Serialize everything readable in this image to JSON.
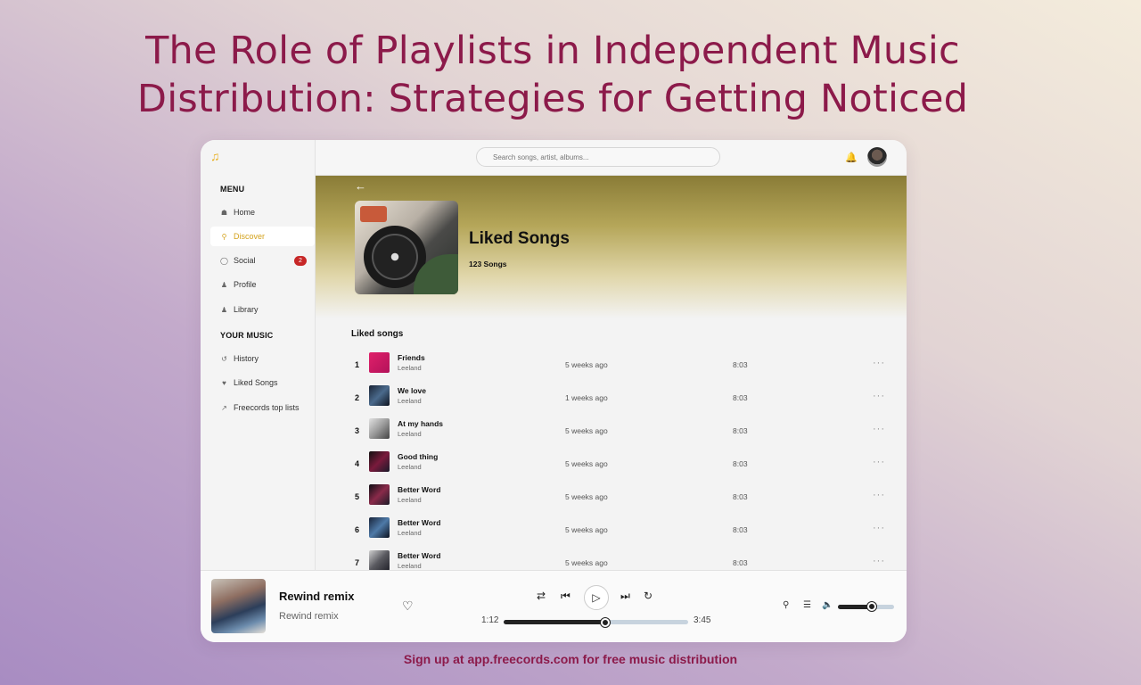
{
  "headline": {
    "line1": "The Role of Playlists in Independent Music",
    "line2": "Distribution: Strategies for Getting Noticed"
  },
  "footer_cta": "Sign up at app.freecords.com for free music distribution",
  "sidebar": {
    "menu_heading": "MENU",
    "items": [
      {
        "label": "Home",
        "icon": "home-icon"
      },
      {
        "label": "Discover",
        "icon": "search-icon",
        "active": true
      },
      {
        "label": "Social",
        "icon": "chat-icon",
        "badge": "2"
      },
      {
        "label": "Profile",
        "icon": "user-icon"
      },
      {
        "label": "Library",
        "icon": "user-icon"
      }
    ],
    "your_music_heading": "YOUR MUSIC",
    "music_items": [
      {
        "label": "History",
        "icon": "history-icon"
      },
      {
        "label": "Liked Songs",
        "icon": "heart-icon"
      },
      {
        "label": "Freecords top lists",
        "icon": "trending-icon"
      }
    ]
  },
  "topbar": {
    "search_placeholder": "Search songs, artist, albums..."
  },
  "hero": {
    "title": "Liked Songs",
    "count": "123 Songs"
  },
  "list": {
    "heading": "Liked songs",
    "rows": [
      {
        "num": "1",
        "title": "Friends",
        "artist": "Leeland",
        "ago": "5 weeks ago",
        "duration": "8:03"
      },
      {
        "num": "2",
        "title": "We love",
        "artist": "Leeland",
        "ago": "1 weeks ago",
        "duration": "8:03"
      },
      {
        "num": "3",
        "title": "At my hands",
        "artist": "Leeland",
        "ago": "5 weeks ago",
        "duration": "8:03"
      },
      {
        "num": "4",
        "title": "Good thing",
        "artist": "Leeland",
        "ago": "5 weeks ago",
        "duration": "8:03"
      },
      {
        "num": "5",
        "title": "Better Word",
        "artist": "Leeland",
        "ago": "5 weeks ago",
        "duration": "8:03"
      },
      {
        "num": "6",
        "title": "Better Word",
        "artist": "Leeland",
        "ago": "5 weeks ago",
        "duration": "8:03"
      },
      {
        "num": "7",
        "title": "Better Word",
        "artist": "Leeland",
        "ago": "5 weeks ago",
        "duration": "8:03"
      }
    ],
    "more_glyph": "···"
  },
  "player": {
    "title": "Rewind remix",
    "artist": "Rewind remix",
    "elapsed": "1:12",
    "total": "3:45",
    "progress": 0.55,
    "volume": 0.6
  },
  "colors": {
    "headline": "#8c1a4a",
    "accent": "#d4a21c",
    "badge": "#c72727"
  }
}
